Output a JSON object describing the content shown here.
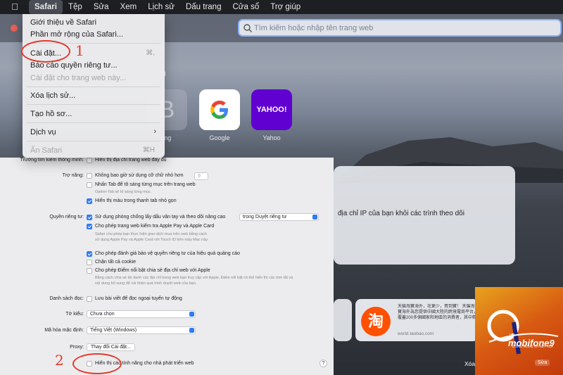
{
  "menubar": {
    "items": [
      "Safari",
      "Tệp",
      "Sửa",
      "Xem",
      "Lịch sử",
      "Dấu trang",
      "Cửa sổ",
      "Trợ giúp"
    ]
  },
  "search": {
    "placeholder": "Tìm kiếm hoặc nhập tên trang web"
  },
  "favorites": {
    "section_partial": "n",
    "items": [
      {
        "letter": "B",
        "label": "ting"
      },
      {
        "label": "Google"
      },
      {
        "label": "Yahoo",
        "logo": "YAHOO!"
      }
    ]
  },
  "privacy": {
    "text": "địa chỉ IP của bạn khỏi các trình theo dõi"
  },
  "taobao": {
    "glyph": "淘",
    "desc": "天猫淘寶海外，花更少，買到寶！ 天猫淘寶海外為您提供中國大陸的跨境電商平台，覆蓋200多個國家和地區的消費者，其中精",
    "url": "world.taobao.com"
  },
  "bottom_text": "Xóa tất cả",
  "watermark": {
    "brand": "mobifone9",
    "vn": ".vn",
    "sub": "CÔNG NGHỆ VÀ KẾT NỐI",
    "edit": "Sửa"
  },
  "dropdown": {
    "about": "Giới thiệu về Safari",
    "extensions": "Phần mở rộng của Safari...",
    "settings": "Cài đặt...",
    "settings_shortcut": "⌘,",
    "privacy_report": "Báo cáo quyền riêng tư...",
    "site_settings": "Cài đặt cho trang web này...",
    "clear_history": "Xóa lịch sử...",
    "create_profile": "Tạo hồ sơ...",
    "services": "Dịch vụ",
    "hide": "Ẩn Safari",
    "hide_shortcut": "⌘H"
  },
  "settings": {
    "search_label": "Trường tìm kiếm thông minh:",
    "search_option": "Hiển thị địa chỉ trang web đầy đủ",
    "access_label": "Trợ năng:",
    "min_font": "Không bao giờ sử dụng cỡ chữ nhỏ hơn",
    "min_font_value": "9",
    "tab_highlight": "Nhấn Tab để tô sáng từng mục trên trang web",
    "tab_note": "Option-Tab sẽ tô sáng từng mục.",
    "color_tab": "Hiển thị màu trong thanh tab nhỏ gọn",
    "privacy_label": "Quyền riêng tư:",
    "fingerprint": "Sử dụng phòng chống lấy dấu vân tay và theo dõi nâng cao",
    "fingerprint_mode": "trong Duyệt riêng tư",
    "applepay": "Cho phép trang web kiểm tra Apple Pay và Apple Card",
    "applepay_note1": "Safari cho phép bạn thực hiện giao dịch mua trên web bằng cách",
    "applepay_note2": "sử dụng Apple Pay và Apple Card với Touch ID trên máy Mac này.",
    "ad_privacy": "Cho phép đánh giá bảo vệ quyền riêng tư của hiệu quả quảng cáo",
    "block_cookies": "Chặn tất cả cookie",
    "highlights": "Cho phép Điểm nổi bật chia sẻ địa chỉ web với Apple",
    "highlights_note1": "Bằng cách chia sẻ ẩn danh các địa chỉ trang web bạn truy cập với Apple, Điểm nổi bật có thể hiển thị các tóm tắt và",
    "highlights_note2": "nội dung bổ sung để cải thiện quá trình duyệt web của bạn.",
    "reading_label": "Danh sách đọc:",
    "reading_offline": "Lưu bài viết để đọc ngoại tuyến tự động",
    "style_label": "Tờ kiểu:",
    "style_value": "Chưa chọn",
    "encoding_label": "Mã hóa mặc định:",
    "encoding_value": "Tiếng Việt (Windows)",
    "proxy_label": "Proxy:",
    "proxy_button": "Thay đổi Cài đặt...",
    "dev_features": "Hiển thị các tính năng cho nhà phát triển web",
    "help": "?"
  },
  "annotations": {
    "one": "1",
    "two": "2"
  },
  "colors": {
    "accent": "#2f7bf6",
    "annotation": "#e23a2b",
    "search_border": "#8ab4f8"
  }
}
